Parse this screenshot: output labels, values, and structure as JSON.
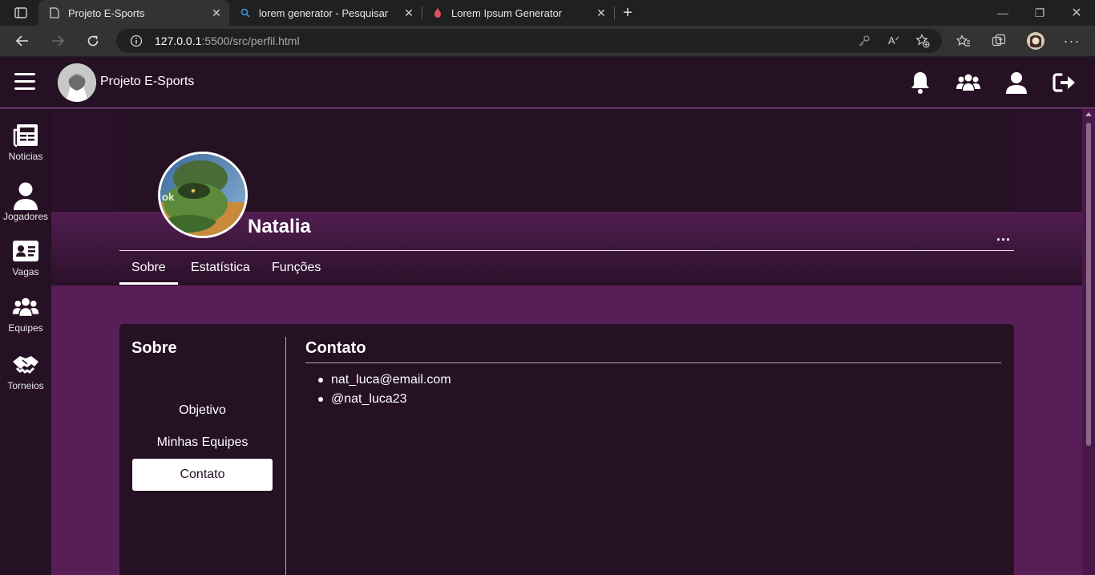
{
  "browser": {
    "tabs": [
      {
        "title": "Projeto E-Sports",
        "active": true,
        "icon": "page-icon"
      },
      {
        "title": "lorem generator - Pesquisar",
        "active": false,
        "icon": "search-icon"
      },
      {
        "title": "Lorem Ipsum Generator",
        "active": false,
        "icon": "fire-icon"
      }
    ],
    "url_host": "127.0.0.1",
    "url_path": ":5500/src/perfil.html"
  },
  "app": {
    "brand": "Projeto E-Sports",
    "topnav_icons": [
      "bell-icon",
      "team-icon",
      "user-icon",
      "logout-icon"
    ]
  },
  "sidebar": {
    "items": [
      {
        "label": "Noticias",
        "icon": "newspaper-icon"
      },
      {
        "label": "Jogadores",
        "icon": "user-icon"
      },
      {
        "label": "Vagas",
        "icon": "id-card-icon"
      },
      {
        "label": "Equipes",
        "icon": "team-icon"
      },
      {
        "label": "Torneios",
        "icon": "handshake-icon"
      }
    ]
  },
  "profile": {
    "name": "Natalia",
    "more": "...",
    "tabs": [
      "Sobre",
      "Estatística",
      "Funções"
    ],
    "active_tab": "Sobre"
  },
  "about": {
    "title": "Sobre",
    "links": [
      "Objetivo",
      "Minhas Equipes",
      "Contato"
    ],
    "active_link": "Contato"
  },
  "contact": {
    "title": "Contato",
    "items": [
      "nat_luca@email.com",
      "@nat_luca23"
    ]
  }
}
